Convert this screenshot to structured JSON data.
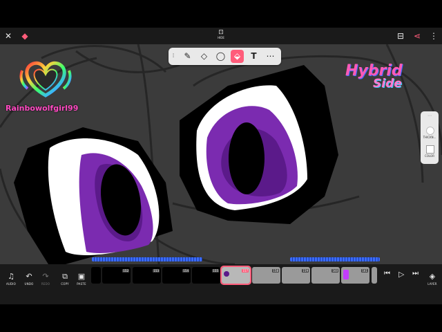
{
  "topbar": {
    "close_icon": "close-icon",
    "gem_icon": "gem-icon",
    "hide_label": "HIDE",
    "fit_icon": "fit-icon",
    "share_icon": "share-icon",
    "more_icon": "more-vertical-icon"
  },
  "toolbar": {
    "tools": [
      "drag-handle",
      "brush",
      "eraser",
      "lasso",
      "fill",
      "text",
      "more"
    ],
    "active_tool": "fill"
  },
  "overlay": {
    "left_logo_text": "Rainbowolfgirl99",
    "right_logo_line1": "Hybrid",
    "right_logo_line2": "Side"
  },
  "side_panel": {
    "thickness_label": "THICKN...",
    "color_label": "COLOR"
  },
  "timeline": {
    "buttons": {
      "audio": "AUDIO",
      "undo": "UNDO",
      "redo": "REDO",
      "copy": "COPY",
      "paste": "PASTE",
      "layer": "LAYER"
    },
    "frame_numbers": [
      "152",
      "153",
      "154",
      "155",
      "157",
      "158",
      "159",
      "160",
      "161"
    ],
    "current_frame": "157"
  },
  "colors": {
    "accent": "#ff4d6d",
    "eye_purple": "#7b2bb0",
    "eye_purple_dark": "#5b1a8a",
    "canvas_bg": "#3b3b3b",
    "timeline_wave": "#3a6bff"
  }
}
